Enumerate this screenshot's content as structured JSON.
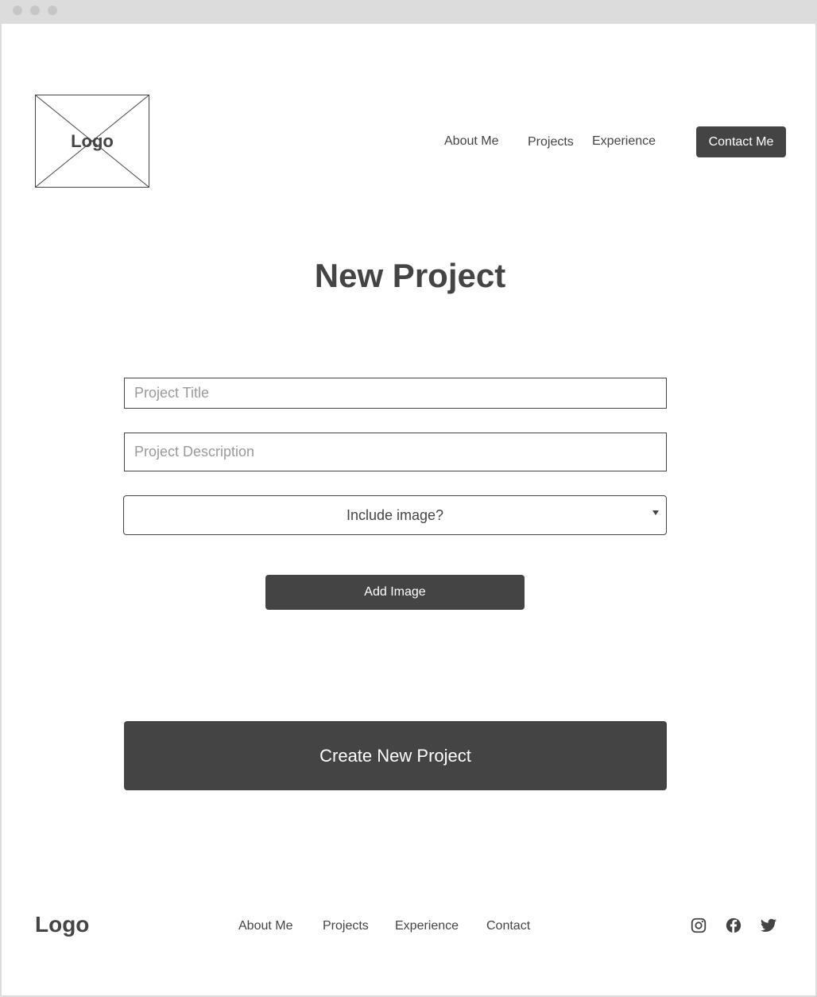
{
  "header": {
    "logo_text": "Logo",
    "nav": [
      {
        "label": "About Me"
      },
      {
        "label": "Projects"
      },
      {
        "label": "Experience"
      }
    ],
    "contact_button": "Contact Me"
  },
  "main": {
    "title": "New Project",
    "project_title": {
      "placeholder": "Project Title",
      "value": ""
    },
    "project_description": {
      "placeholder": "Project Description",
      "value": ""
    },
    "include_image_select": {
      "selected": "Include image?"
    },
    "add_image_button": "Add Image",
    "create_button": "Create New Project"
  },
  "footer": {
    "logo_text": "Logo",
    "links": [
      {
        "label": "About Me"
      },
      {
        "label": "Projects"
      },
      {
        "label": "Experience"
      },
      {
        "label": "Contact"
      }
    ],
    "social_icons": [
      "instagram-icon",
      "facebook-icon",
      "twitter-icon"
    ]
  },
  "colors": {
    "primary": "#444444",
    "background": "#ffffff",
    "chrome": "#dcdcdc",
    "placeholder": "#9a9a9a"
  }
}
